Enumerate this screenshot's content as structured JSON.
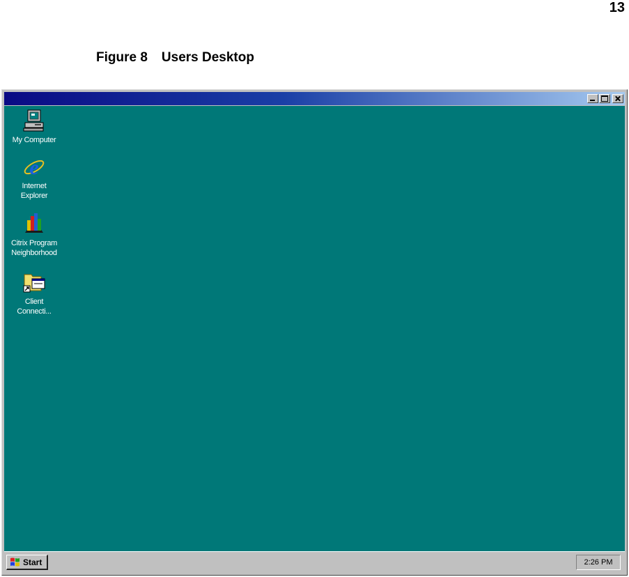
{
  "page": {
    "number": "13",
    "caption_number": "Figure 8",
    "caption_title": "Users Desktop"
  },
  "window": {
    "buttons": [
      "minimize-icon",
      "maximize-icon",
      "close-icon"
    ]
  },
  "desktop": {
    "background": "#007878",
    "icons": [
      {
        "line1": "My Computer",
        "line2": "",
        "icon": "computer-icon"
      },
      {
        "line1": "Internet",
        "line2": "Explorer",
        "icon": "internet-explorer-icon"
      },
      {
        "line1": "Citrix Program",
        "line2": "Neighborhood",
        "icon": "citrix-program-neighborhood-icon"
      },
      {
        "line1": "Client",
        "line2": "Connecti...",
        "icon": "client-connection-shortcut-icon"
      }
    ]
  },
  "taskbar": {
    "start_label": "Start",
    "clock": "2:26 PM"
  }
}
